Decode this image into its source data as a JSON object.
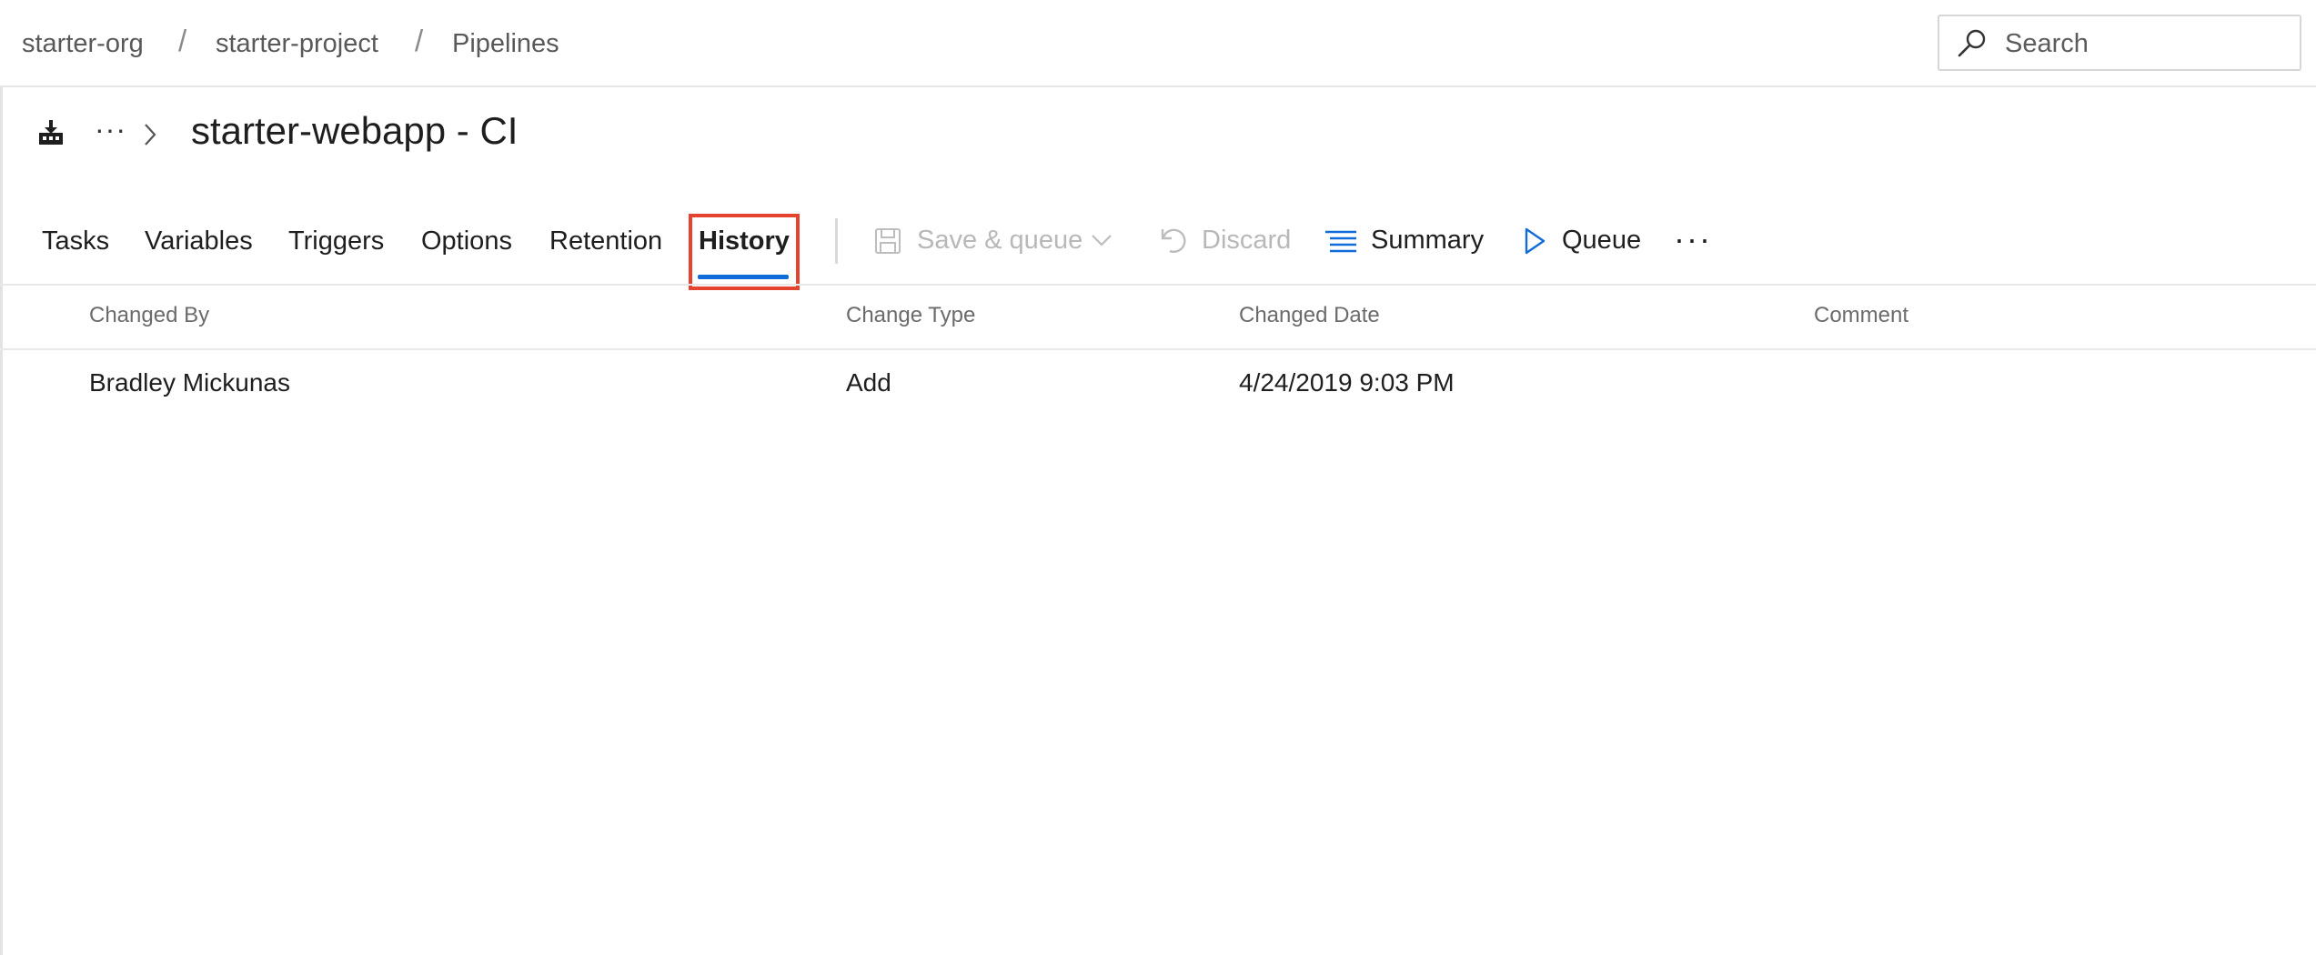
{
  "breadcrumb": {
    "org": "starter-org",
    "project": "starter-project",
    "section": "Pipelines",
    "separator": "/"
  },
  "search": {
    "placeholder": "Search",
    "icon": "search-icon"
  },
  "pipeline": {
    "icon": "pipeline-icon",
    "more_label": "···",
    "title": "starter-webapp - CI"
  },
  "tabs": [
    {
      "label": "Tasks",
      "active": false
    },
    {
      "label": "Variables",
      "active": false
    },
    {
      "label": "Triggers",
      "active": false
    },
    {
      "label": "Options",
      "active": false
    },
    {
      "label": "Retention",
      "active": false
    },
    {
      "label": "History",
      "active": true
    }
  ],
  "toolbar": {
    "save_queue": {
      "label": "Save & queue",
      "icon": "save-icon",
      "enabled": false
    },
    "discard": {
      "label": "Discard",
      "icon": "undo-icon",
      "enabled": false
    },
    "summary": {
      "label": "Summary",
      "icon": "list-icon",
      "enabled": true
    },
    "queue": {
      "label": "Queue",
      "icon": "play-icon",
      "enabled": true
    },
    "more": "···"
  },
  "history_table": {
    "columns": [
      "Changed By",
      "Change Type",
      "Changed Date",
      "Comment"
    ],
    "rows": [
      {
        "changed_by": "Bradley Mickunas",
        "change_type": "Add",
        "changed_date": "4/24/2019 9:03 PM",
        "comment": ""
      }
    ]
  },
  "colors": {
    "accent": "#0f6cd9",
    "highlight_box": "#e5432f",
    "disabled_text": "#b8b8b8"
  }
}
